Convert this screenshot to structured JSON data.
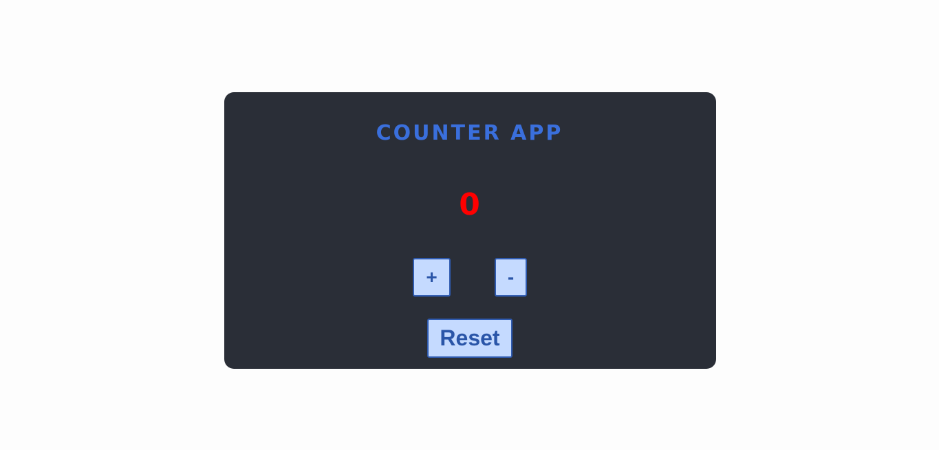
{
  "app": {
    "title": "COUNTER APP",
    "count": "0"
  },
  "controls": {
    "increment_label": "+",
    "decrement_label": "-",
    "reset_label": "Reset"
  },
  "colors": {
    "title": "#3a6fdc",
    "count": "#ff0000",
    "card_background": "#2a2e37",
    "button_background": "#c5daff",
    "button_text": "#2a55a8",
    "page_background": "#fdfdfd"
  }
}
